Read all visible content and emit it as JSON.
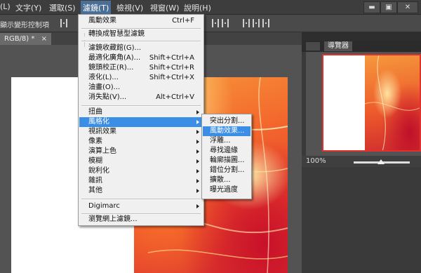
{
  "menubar": {
    "items": [
      "(L)",
      "文字(Y)",
      "選取(S)",
      "濾鏡(T)",
      "檢視(V)",
      "視窗(W)",
      "說明(H)"
    ],
    "active_index": 3
  },
  "window_controls": {
    "minimize": "▬",
    "restore": "▣",
    "close": "✕"
  },
  "options_bar": {
    "label": "顯示變形控制項"
  },
  "document": {
    "tab_label": "RGB/8) *",
    "tab_close": "×"
  },
  "navigator": {
    "tab_label": "導覽器",
    "zoom": "100%"
  },
  "filter_menu": {
    "items": [
      {
        "label": "風動效果",
        "shortcut": "Ctrl+F"
      },
      {
        "label": "轉換成智慧型濾鏡"
      },
      {
        "label": "濾鏡收藏館(G)..."
      },
      {
        "label": "最適化廣角(A)...",
        "shortcut": "Shift+Ctrl+A"
      },
      {
        "label": "鏡頭校正(R)...",
        "shortcut": "Shift+Ctrl+R"
      },
      {
        "label": "液化(L)...",
        "shortcut": "Shift+Ctrl+X"
      },
      {
        "label": "油畫(O)..."
      },
      {
        "label": "消失點(V)...",
        "shortcut": "Alt+Ctrl+V"
      },
      {
        "label": "扭曲"
      },
      {
        "label": "風格化"
      },
      {
        "label": "視訊效果"
      },
      {
        "label": "像素"
      },
      {
        "label": "演算上色"
      },
      {
        "label": "模糊"
      },
      {
        "label": "銳利化"
      },
      {
        "label": "雜訊"
      },
      {
        "label": "其他"
      },
      {
        "label": "Digimarc"
      },
      {
        "label": "瀏覽網上濾鏡..."
      }
    ]
  },
  "stylize_submenu": {
    "items": [
      "突出分割...",
      "風動效果...",
      "浮雕...",
      "尋找邊緣",
      "輪廓描圖...",
      "錯位分割...",
      "擴散...",
      "曝光過度"
    ],
    "highlighted_index": 1
  },
  "colors": {
    "highlight": "#3a8ee6",
    "menu_bg": "#f0f0f0",
    "ui_dark": "#3d3d3d"
  }
}
